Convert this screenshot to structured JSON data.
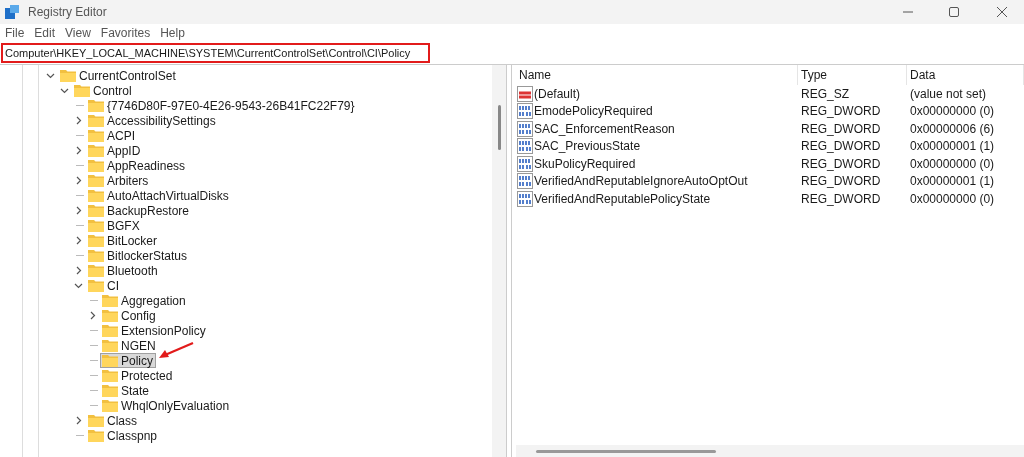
{
  "window": {
    "title": "Registry Editor"
  },
  "menu": [
    "File",
    "Edit",
    "View",
    "Favorites",
    "Help"
  ],
  "address": {
    "value": "Computer\\HKEY_LOCAL_MACHINE\\SYSTEM\\CurrentControlSet\\Control\\CI\\Policy",
    "highlighted": true
  },
  "tree": [
    {
      "label": "CurrentControlSet",
      "kind": "branch",
      "expanded": true,
      "selected": false,
      "children": [
        {
          "label": "Control",
          "kind": "branch",
          "expanded": true,
          "selected": false,
          "children": [
            {
              "label": "{7746D80F-97E0-4E26-9543-26B41FC22F79}",
              "kind": "leaf",
              "selected": false
            },
            {
              "label": "AccessibilitySettings",
              "kind": "branch",
              "expanded": false,
              "selected": false
            },
            {
              "label": "ACPI",
              "kind": "leaf",
              "selected": false
            },
            {
              "label": "AppID",
              "kind": "branch",
              "expanded": false,
              "selected": false
            },
            {
              "label": "AppReadiness",
              "kind": "leaf",
              "selected": false
            },
            {
              "label": "Arbiters",
              "kind": "branch",
              "expanded": false,
              "selected": false
            },
            {
              "label": "AutoAttachVirtualDisks",
              "kind": "leaf",
              "selected": false
            },
            {
              "label": "BackupRestore",
              "kind": "branch",
              "expanded": false,
              "selected": false
            },
            {
              "label": "BGFX",
              "kind": "leaf",
              "selected": false
            },
            {
              "label": "BitLocker",
              "kind": "branch",
              "expanded": false,
              "selected": false
            },
            {
              "label": "BitlockerStatus",
              "kind": "leaf",
              "selected": false
            },
            {
              "label": "Bluetooth",
              "kind": "branch",
              "expanded": false,
              "selected": false
            },
            {
              "label": "CI",
              "kind": "branch",
              "expanded": true,
              "selected": false,
              "children": [
                {
                  "label": "Aggregation",
                  "kind": "leaf",
                  "selected": false
                },
                {
                  "label": "Config",
                  "kind": "branch",
                  "expanded": false,
                  "selected": false
                },
                {
                  "label": "ExtensionPolicy",
                  "kind": "leaf",
                  "selected": false
                },
                {
                  "label": "NGEN",
                  "kind": "leaf",
                  "selected": false
                },
                {
                  "label": "Policy",
                  "kind": "leaf",
                  "selected": true,
                  "annotated": true
                },
                {
                  "label": "Protected",
                  "kind": "leaf",
                  "selected": false
                },
                {
                  "label": "State",
                  "kind": "leaf",
                  "selected": false
                },
                {
                  "label": "WhqlOnlyEvaluation",
                  "kind": "leaf",
                  "selected": false
                }
              ]
            },
            {
              "label": "Class",
              "kind": "branch",
              "expanded": false,
              "selected": false
            },
            {
              "label": "Classpnp",
              "kind": "leaf",
              "selected": false
            }
          ]
        }
      ]
    }
  ],
  "table": {
    "columns": [
      "Name",
      "Type",
      "Data"
    ],
    "rows": [
      {
        "kind": "string",
        "name": "(Default)",
        "type": "REG_SZ",
        "data": "(value not set)"
      },
      {
        "kind": "binary",
        "name": "EmodePolicyRequired",
        "type": "REG_DWORD",
        "data": "0x00000000 (0)"
      },
      {
        "kind": "binary",
        "name": "SAC_EnforcementReason",
        "type": "REG_DWORD",
        "data": "0x00000006 (6)"
      },
      {
        "kind": "binary",
        "name": "SAC_PreviousState",
        "type": "REG_DWORD",
        "data": "0x00000001 (1)"
      },
      {
        "kind": "binary",
        "name": "SkuPolicyRequired",
        "type": "REG_DWORD",
        "data": "0x00000000 (0)"
      },
      {
        "kind": "binary",
        "name": "VerifiedAndReputableIgnoreAutoOptOut",
        "type": "REG_DWORD",
        "data": "0x00000001 (1)"
      },
      {
        "kind": "binary",
        "name": "VerifiedAndReputablePolicyState",
        "type": "REG_DWORD",
        "data": "0x00000000 (0)"
      }
    ]
  }
}
